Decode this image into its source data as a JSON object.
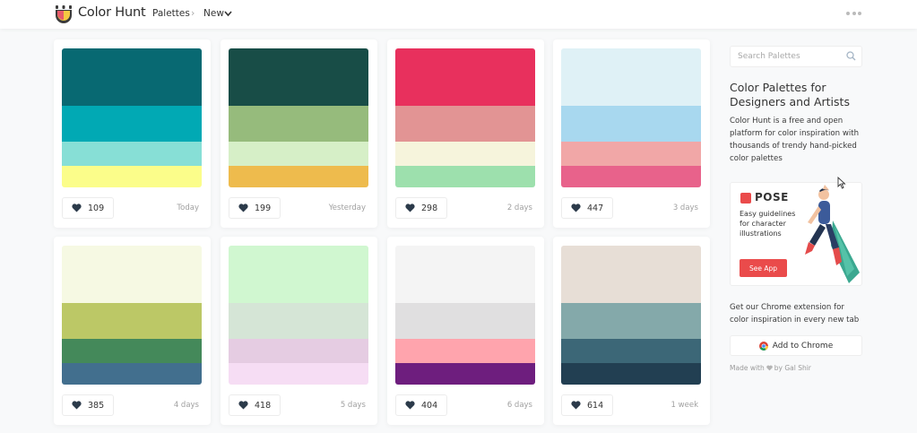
{
  "header": {
    "brand": "Color Hunt",
    "breadcrumb_root": "Palettes",
    "breadcrumb_current": "New"
  },
  "palettes": [
    {
      "colors": [
        "#086972",
        "#01a9b4",
        "#87dfd6",
        "#fbfd8a"
      ],
      "likes": "109",
      "date": "Today"
    },
    {
      "colors": [
        "#184d47",
        "#96bb7c",
        "#d6efc7",
        "#eebb4d"
      ],
      "likes": "199",
      "date": "Yesterday"
    },
    {
      "colors": [
        "#e8305d",
        "#e29494",
        "#f6f4dc",
        "#9de0ad"
      ],
      "likes": "298",
      "date": "2 days"
    },
    {
      "colors": [
        "#dff1f6",
        "#a8d8ef",
        "#f1a7a7",
        "#e8628b"
      ],
      "likes": "447",
      "date": "3 days"
    },
    {
      "colors": [
        "#f6f9e3",
        "#bcc866",
        "#44895a",
        "#426f8e"
      ],
      "likes": "385",
      "date": "4 days"
    },
    {
      "colors": [
        "#d0f7d0",
        "#d5e5d6",
        "#e5cce2",
        "#f6ddf4"
      ],
      "likes": "418",
      "date": "5 days"
    },
    {
      "colors": [
        "#f4f4f4",
        "#e0dfe0",
        "#ffa4ad",
        "#6e1e7e"
      ],
      "likes": "404",
      "date": "6 days"
    },
    {
      "colors": [
        "#e7ded6",
        "#84a9aa",
        "#3c6777",
        "#223f52"
      ],
      "likes": "614",
      "date": "1 week"
    }
  ],
  "sidebar": {
    "search_placeholder": "Search Palettes",
    "title": "Color Palettes for Designers and Artists",
    "description": "Color Hunt is a free and open platform for color inspiration with thousands of trendy hand-picked color palettes",
    "ad": {
      "brand": "POSE",
      "text": "Easy guidelines for character illustrations",
      "button": "See App"
    },
    "extension_text": "Get our Chrome extension for color inspiration in every new tab",
    "chrome_button": "Add to Chrome",
    "made_with_prefix": "Made with",
    "made_with_suffix": "by Gal Shir"
  }
}
